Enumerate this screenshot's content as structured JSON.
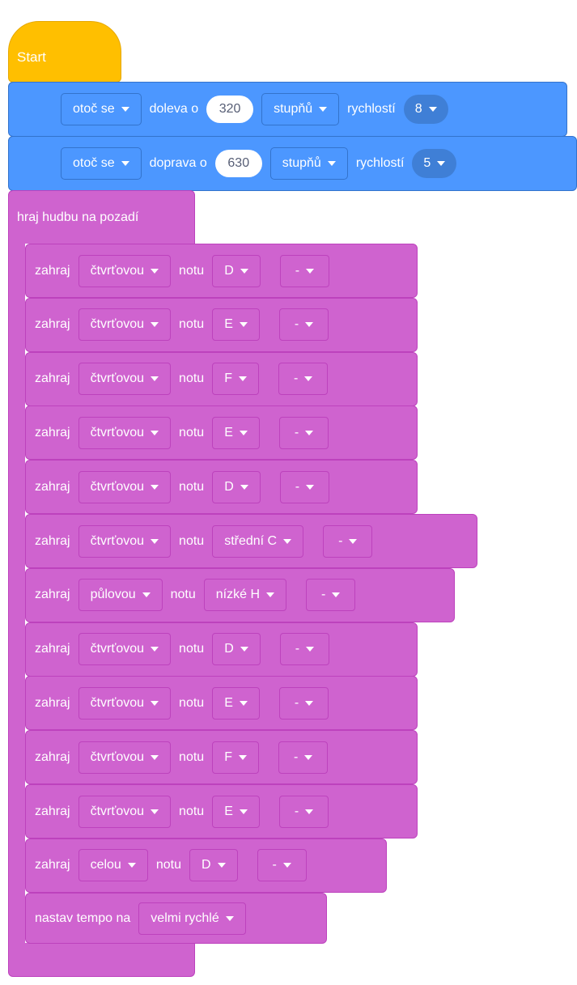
{
  "hat": {
    "label": "Start"
  },
  "motion_blocks": [
    {
      "action": "otoč se",
      "direction": "doleva o",
      "degrees": "320",
      "unit": "stupňů",
      "speed_label": "rychlostí",
      "speed": "8"
    },
    {
      "action": "otoč se",
      "direction": "doprava o",
      "degrees": "630",
      "unit": "stupňů",
      "speed_label": "rychlostí",
      "speed": "5"
    }
  ],
  "music_block": {
    "label": "hraj hudbu na pozadí"
  },
  "play_blocks": [
    {
      "verb": "zahraj",
      "duration": "čtvrťovou",
      "note_label": "notu",
      "note": "D",
      "mod": "-"
    },
    {
      "verb": "zahraj",
      "duration": "čtvrťovou",
      "note_label": "notu",
      "note": "E",
      "mod": "-"
    },
    {
      "verb": "zahraj",
      "duration": "čtvrťovou",
      "note_label": "notu",
      "note": "F",
      "mod": "-"
    },
    {
      "verb": "zahraj",
      "duration": "čtvrťovou",
      "note_label": "notu",
      "note": "E",
      "mod": "-"
    },
    {
      "verb": "zahraj",
      "duration": "čtvrťovou",
      "note_label": "notu",
      "note": "D",
      "mod": "-"
    },
    {
      "verb": "zahraj",
      "duration": "čtvrťovou",
      "note_label": "notu",
      "note": "střední C",
      "mod": "-"
    },
    {
      "verb": "zahraj",
      "duration": "půlovou",
      "note_label": "notu",
      "note": "nízké H",
      "mod": "-"
    },
    {
      "verb": "zahraj",
      "duration": "čtvrťovou",
      "note_label": "notu",
      "note": "D",
      "mod": "-"
    },
    {
      "verb": "zahraj",
      "duration": "čtvrťovou",
      "note_label": "notu",
      "note": "E",
      "mod": "-"
    },
    {
      "verb": "zahraj",
      "duration": "čtvrťovou",
      "note_label": "notu",
      "note": "F",
      "mod": "-"
    },
    {
      "verb": "zahraj",
      "duration": "čtvrťovou",
      "note_label": "notu",
      "note": "E",
      "mod": "-"
    },
    {
      "verb": "zahraj",
      "duration": "celou",
      "note_label": "notu",
      "note": "D",
      "mod": "-"
    }
  ],
  "tempo_block": {
    "label": "nastav tempo na",
    "value": "velmi rychlé"
  },
  "colors": {
    "event": "#ffbf00",
    "motion": "#4c97ff",
    "sound": "#cf63cf"
  }
}
